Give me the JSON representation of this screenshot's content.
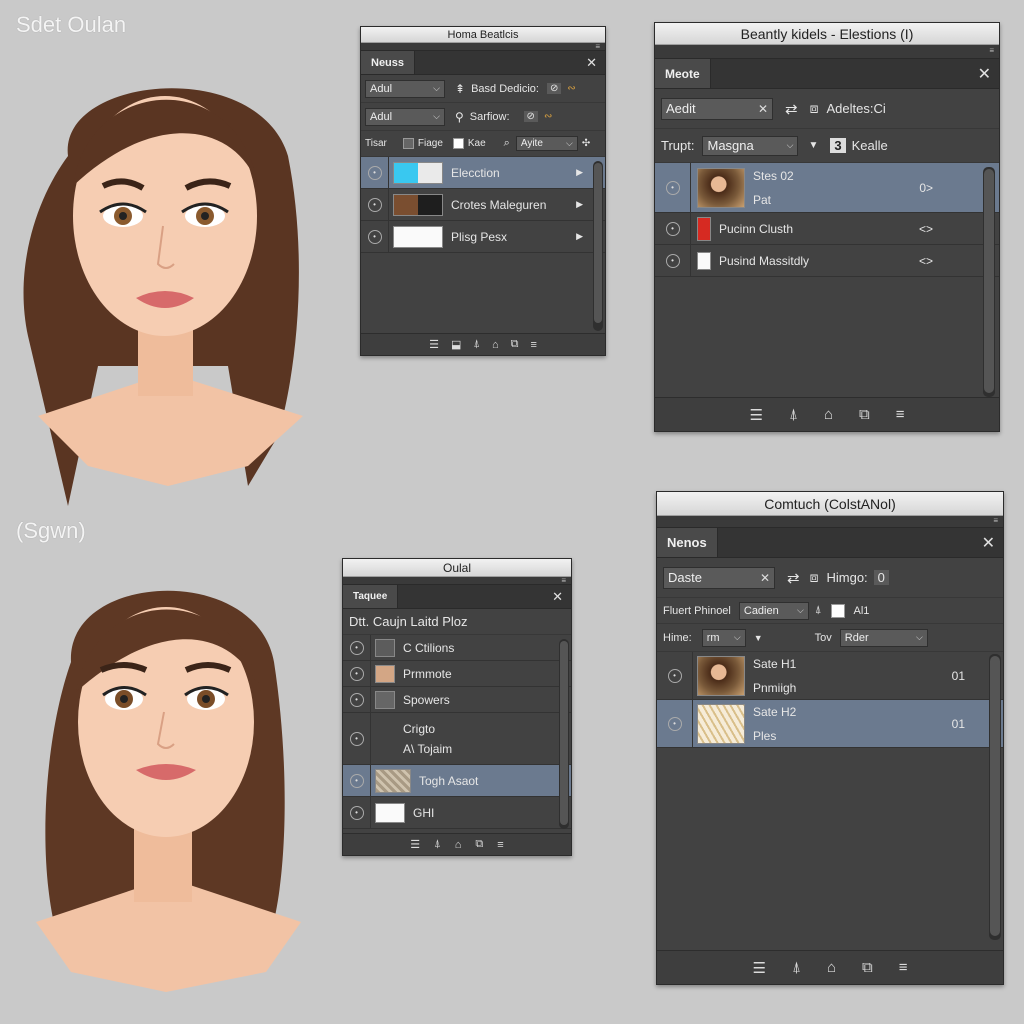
{
  "canvas": {
    "label_top": "Sdet Oulan",
    "label_bottom": "(Sgwn)"
  },
  "panel1": {
    "title": "Homa Beatlcis",
    "tab": "Neuss",
    "row1_select": "Adul",
    "row1_label": "Basd Dedicio:",
    "row2_select": "Adul",
    "row2_label": "Sarfiow:",
    "opt_label": "Tisar",
    "opt_a": "Fiage",
    "opt_b": "Kae",
    "opt_c_select": "Ayite",
    "layers": [
      {
        "name": "Elecction",
        "selected": true,
        "thumb": "cyan-white"
      },
      {
        "name": "Crotes Maleguren",
        "selected": false,
        "thumb": "brown-black"
      },
      {
        "name": "Plisg Pesx",
        "selected": false,
        "thumb": "white"
      }
    ]
  },
  "panel2": {
    "title": "Beantly kidels - Elestions (I)",
    "tab": "Meote",
    "select": "Aedit",
    "select_label": "Adeltes:Ci",
    "filter_label": "Trupt:",
    "filter_select": "Masgna",
    "badge": "3",
    "badge_label": "Kealle",
    "layers": [
      {
        "name": "Stes 02",
        "sub": "Pat",
        "value": "0>",
        "selected": true,
        "thumb": "portrait"
      },
      {
        "name": "Pucinn Clusth",
        "value": "<>",
        "selected": false,
        "thumb": "red"
      },
      {
        "name": "Pusind Massitdly",
        "value": "<>",
        "selected": false,
        "thumb": "white"
      }
    ]
  },
  "panel3": {
    "title": "Oulal",
    "tab": "Taquee",
    "heading": "Dtt. Caujn Laitd Ploz",
    "layers": [
      {
        "name": "C Ctilions",
        "selected": false,
        "thumb": "brush"
      },
      {
        "name": "Prmmote",
        "selected": false,
        "thumb": "skin"
      },
      {
        "name": "Spowers",
        "selected": false,
        "thumb": "arrow"
      },
      {
        "name": "Crigto",
        "sub": "A\\ Tojaim",
        "selected": false,
        "thumb": "none"
      },
      {
        "name": "Togh Asaot",
        "selected": true,
        "thumb": "texture"
      },
      {
        "name": "GHI",
        "selected": false,
        "thumb": "white"
      }
    ]
  },
  "panel4": {
    "title": "Comtuch (ColstANol)",
    "tab": "Nenos",
    "select": "Daste",
    "select_label": "Himgo:",
    "select_value": "0",
    "r1_label": "Fluert Phinoel",
    "r1_select": "Cadien",
    "r1_value": "Al1",
    "r2_label": "Hime:",
    "r2_select": "rm",
    "r2_label2": "Tov",
    "r2_select2": "Rder",
    "layers": [
      {
        "name": "Sate H1",
        "sub": "Pnmiigh",
        "value": "01",
        "selected": false,
        "thumb": "portrait"
      },
      {
        "name": "Sate H2",
        "sub": "Ples",
        "value": "01",
        "selected": true,
        "thumb": "lace"
      }
    ]
  },
  "icons": {
    "footer": [
      "stack-icon",
      "fill-icon",
      "mask-icon",
      "folder-icon",
      "menu-icon"
    ]
  },
  "colors": {
    "panel_bg": "#424242",
    "selection": "#6b7a8f",
    "canvas_bg": "#c9c9c9"
  }
}
